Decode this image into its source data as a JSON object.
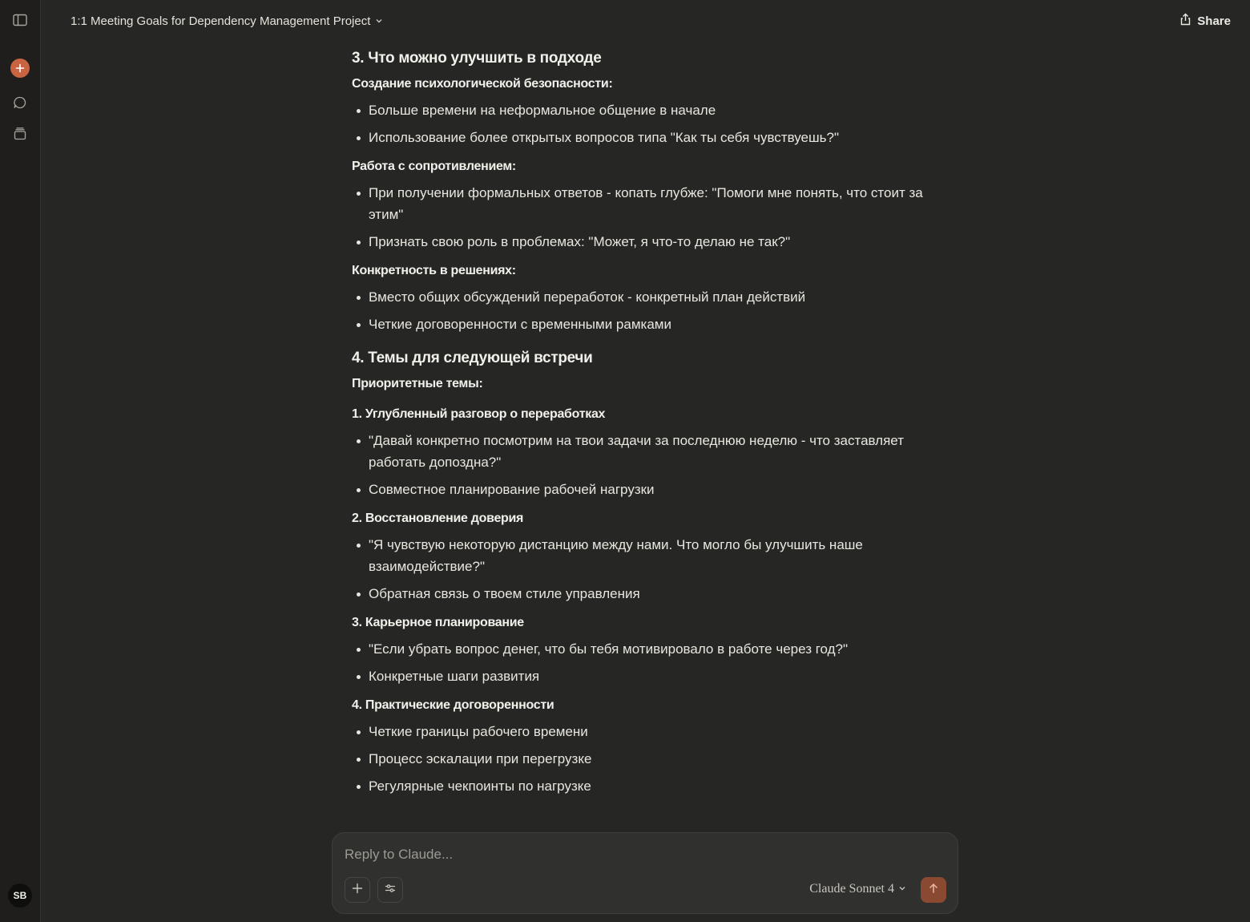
{
  "header": {
    "title": "1:1 Meeting Goals for Dependency Management Project",
    "share_label": "Share"
  },
  "sidebar": {
    "avatar_initials": "SB",
    "accent_color": "#C96442"
  },
  "content": {
    "section3": {
      "heading": "3. Что можно улучшить в подходе",
      "groups": [
        {
          "title": "Создание психологической безопасности:",
          "bullets": [
            "Больше времени на неформальное общение в начале",
            "Использование более открытых вопросов типа \"Как ты себя чувствуешь?\""
          ]
        },
        {
          "title": "Работа с сопротивлением:",
          "bullets": [
            "При получении формальных ответов - копать глубже: \"Помоги мне понять, что стоит за этим\"",
            "Признать свою роль в проблемах: \"Может, я что-то делаю не так?\""
          ]
        },
        {
          "title": "Конкретность в решениях:",
          "bullets": [
            "Вместо общих обсуждений переработок - конкретный план действий",
            "Четкие договоренности с временными рамками"
          ]
        }
      ]
    },
    "section4": {
      "heading": "4. Темы для следующей встречи",
      "intro": "Приоритетные темы:",
      "topics": [
        {
          "title": "1. Углубленный разговор о переработках",
          "bullets": [
            "\"Давай конкретно посмотрим на твои задачи за последнюю неделю - что заставляет работать допоздна?\"",
            "Совместное планирование рабочей нагрузки"
          ]
        },
        {
          "title": "2. Восстановление доверия",
          "bullets": [
            "\"Я чувствую некоторую дистанцию между нами. Что могло бы улучшить наше взаимодействие?\"",
            "Обратная связь о твоем стиле управления"
          ]
        },
        {
          "title": "3. Карьерное планирование",
          "bullets": [
            "\"Если убрать вопрос денег, что бы тебя мотивировало в работе через год?\"",
            "Конкретные шаги развития"
          ]
        },
        {
          "title": "4. Практические договоренности",
          "bullets": [
            "Четкие границы рабочего времени",
            "Процесс эскалации при перегрузке",
            "Регулярные чекпоинты по нагрузке"
          ]
        }
      ]
    }
  },
  "composer": {
    "placeholder": "Reply to Claude...",
    "model_label": "Claude Sonnet 4",
    "send_color": "#8A4A32"
  }
}
